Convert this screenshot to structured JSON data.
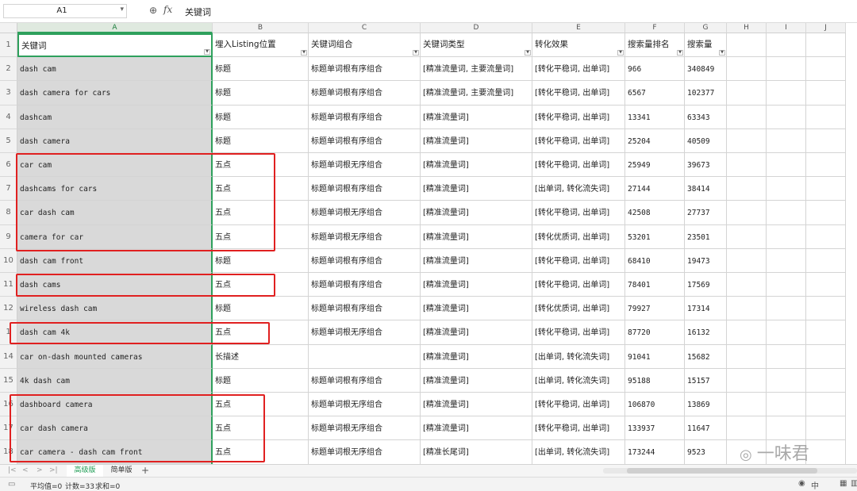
{
  "formula_bar": {
    "name_box": "A1",
    "zoom_icon": "zoom-icon",
    "fx_label": "fx",
    "content": "关键词"
  },
  "columns": [
    "A",
    "B",
    "C",
    "D",
    "E",
    "F",
    "G",
    "H",
    "I",
    "J"
  ],
  "header_row": [
    "关键词",
    "埋入Listing位置",
    "关键词组合",
    "关键词类型",
    "转化效果",
    "搜索量排名",
    "搜索量"
  ],
  "rows": [
    {
      "n": "2",
      "cells": [
        "dash cam",
        "标题",
        "标题单词根有序组合",
        "[精准流量词, 主要流量词]",
        "[转化平稳词, 出单词]",
        "966",
        "340849"
      ]
    },
    {
      "n": "3",
      "cells": [
        "dash camera for cars",
        "标题",
        "标题单词根有序组合",
        "[精准流量词, 主要流量词]",
        "[转化平稳词, 出单词]",
        "6567",
        "102377"
      ]
    },
    {
      "n": "4",
      "cells": [
        "dashcam",
        "标题",
        "标题单词根有序组合",
        "[精准流量词]",
        "[转化平稳词, 出单词]",
        "13341",
        "63343"
      ]
    },
    {
      "n": "5",
      "cells": [
        "dash camera",
        "标题",
        "标题单词根有序组合",
        "[精准流量词]",
        "[转化平稳词, 出单词]",
        "25204",
        "40509"
      ]
    },
    {
      "n": "6",
      "cells": [
        "car cam",
        "五点",
        "标题单词根无序组合",
        "[精准流量词]",
        "[转化平稳词, 出单词]",
        "25949",
        "39673"
      ]
    },
    {
      "n": "7",
      "cells": [
        "dashcams for cars",
        "五点",
        "标题单词根有序组合",
        "[精准流量词]",
        "[出单词, 转化流失词]",
        "27144",
        "38414"
      ]
    },
    {
      "n": "8",
      "cells": [
        "car dash cam",
        "五点",
        "标题单词根无序组合",
        "[精准流量词]",
        "[转化平稳词, 出单词]",
        "42508",
        "27737"
      ]
    },
    {
      "n": "9",
      "cells": [
        "camera for car",
        "五点",
        "标题单词根无序组合",
        "[精准流量词]",
        "[转化优质词, 出单词]",
        "53201",
        "23501"
      ]
    },
    {
      "n": "10",
      "cells": [
        "dash cam front",
        "标题",
        "标题单词根有序组合",
        "[精准流量词]",
        "[转化平稳词, 出单词]",
        "68410",
        "19473"
      ]
    },
    {
      "n": "11",
      "cells": [
        "dash cams",
        "五点",
        "标题单词根有序组合",
        "[精准流量词]",
        "[转化平稳词, 出单词]",
        "78401",
        "17569"
      ]
    },
    {
      "n": "12",
      "cells": [
        "wireless dash cam",
        "标题",
        "标题单词根有序组合",
        "[精准流量词]",
        "[转化优质词, 出单词]",
        "79927",
        "17314"
      ]
    },
    {
      "n": "1",
      "cells": [
        "dash cam 4k",
        "五点",
        "标题单词根无序组合",
        "[精准流量词]",
        "[转化平稳词, 出单词]",
        "87720",
        "16132"
      ]
    },
    {
      "n": "14",
      "cells": [
        "car on-dash mounted cameras",
        "长描述",
        "",
        "[精准流量词]",
        "[出单词, 转化流失词]",
        "91041",
        "15682"
      ]
    },
    {
      "n": "15",
      "cells": [
        "4k dash cam",
        "标题",
        "标题单词根有序组合",
        "[精准流量词]",
        "[出单词, 转化流失词]",
        "95188",
        "15157"
      ]
    },
    {
      "n": "16",
      "cells": [
        "dashboard camera",
        "五点",
        "标题单词根无序组合",
        "[精准流量词]",
        "[转化平稳词, 出单词]",
        "106870",
        "13869"
      ]
    },
    {
      "n": "17",
      "cells": [
        "car dash camera",
        "五点",
        "标题单词根无序组合",
        "[精准流量词]",
        "[转化平稳词, 出单词]",
        "133937",
        "11647"
      ]
    },
    {
      "n": "18",
      "cells": [
        "car camera - dash cam front",
        "五点",
        "标题单词根无序组合",
        "[精准长尾词]",
        "[出单词, 转化流失词]",
        "173244",
        "9523"
      ]
    }
  ],
  "sheet_tabs": [
    "高级版",
    "简单版"
  ],
  "add_tab": "+",
  "status": {
    "average": "平均值=0",
    "count": "计数=33",
    "sum": "求和=0"
  },
  "watermark": "一味君",
  "colors": {
    "accent_green": "#2ea05c",
    "highlight_red": "#e02020",
    "colA_fill": "#d9d9d9"
  }
}
